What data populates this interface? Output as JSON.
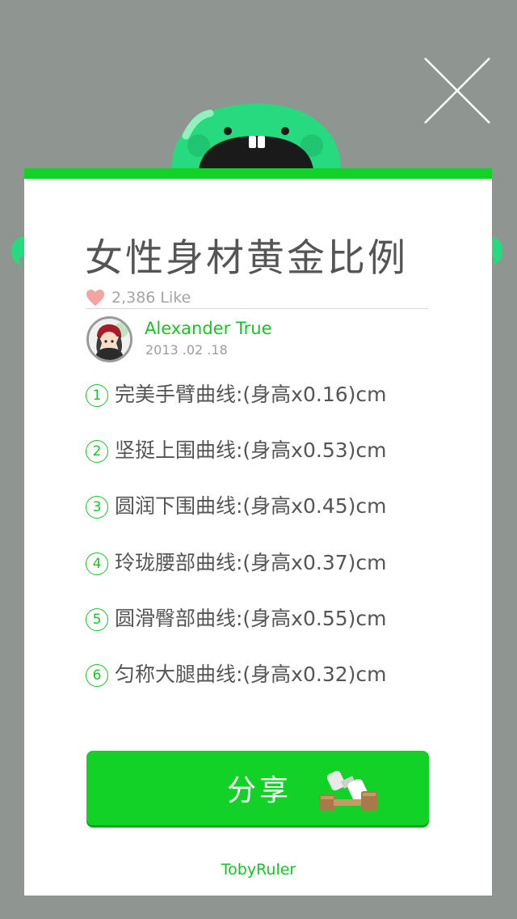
{
  "article": {
    "title": "女性身材黄金比例",
    "likes": "2,386 Like"
  },
  "author": {
    "name": "Alexander True",
    "date": "2013 .02 .18"
  },
  "items": [
    {
      "num": "1",
      "text": "完美手臂曲线:(身高x0.16)cm"
    },
    {
      "num": "2",
      "text": "坚挺上围曲线:(身高x0.53)cm"
    },
    {
      "num": "3",
      "text": "圆润下围曲线:(身高x0.45)cm"
    },
    {
      "num": "4",
      "text": "玲珑腰部曲线:(身高x0.37)cm"
    },
    {
      "num": "5",
      "text": "圆滑臀部曲线:(身高x0.55)cm"
    },
    {
      "num": "6",
      "text": "匀称大腿曲线:(身高x0.32)cm"
    }
  ],
  "share": {
    "label": "分享"
  },
  "footer": {
    "brand": "TobyRuler"
  },
  "colors": {
    "accent": "#12d127",
    "background": "#8f9590",
    "monster": "#27d97f",
    "like_heart": "#f4a3a3"
  },
  "icons": {
    "close": "close-icon",
    "heart": "heart-icon",
    "dumbbell": "dumbbell-icon",
    "mascot": "monster-mascot"
  }
}
